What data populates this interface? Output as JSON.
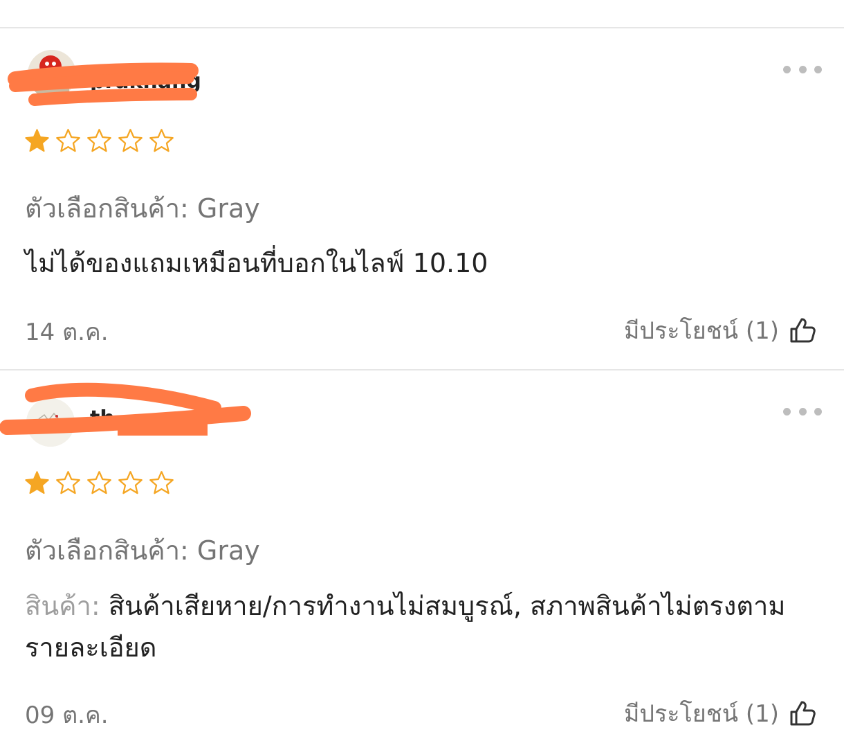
{
  "reviews": [
    {
      "username": "prakhang",
      "rating": 1,
      "max_rating": 5,
      "variant": "ตัวเลือกสินค้า: Gray",
      "comment_label": "",
      "comment": "ไม่ได้ของแถมเหมือนที่บอกในไลฟ์ 10.10",
      "date": "14 ต.ค.",
      "helpful": "มีประโยชน์ (1)",
      "avatar_icon": "red-mascot-avatar-icon",
      "more_icon": "more-horizontal-icon",
      "like_icon": "thumbs-up-icon"
    },
    {
      "username": "th",
      "rating": 1,
      "max_rating": 5,
      "variant": "ตัวเลือกสินค้า: Gray",
      "comment_label": "สินค้า: ",
      "comment": "สินค้าเสียหาย/การทำงานไม่สมบูรณ์, สภาพสินค้าไม่ตรงตามรายละเอียด",
      "date": "09 ต.ค.",
      "helpful": "มีประโยชน์ (1)",
      "avatar_icon": "sketch-avatar-icon",
      "more_icon": "more-horizontal-icon",
      "like_icon": "thumbs-up-icon"
    }
  ],
  "colors": {
    "star_filled": "#F5A623",
    "star_empty_outline": "#F5A623",
    "redaction": "#FF7A45",
    "secondary_text": "#757575",
    "divider": "#E6E6E6"
  }
}
